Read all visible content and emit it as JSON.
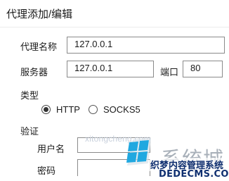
{
  "dialog": {
    "title": "代理添加/编辑"
  },
  "form": {
    "proxy_name_label": "代理名称",
    "proxy_name_value": "127.0.0.1",
    "server_label": "服务器",
    "server_value": "127.0.0.1",
    "port_label": "端口",
    "port_value": "80",
    "type_label": "类型",
    "type_options": [
      {
        "label": "HTTP",
        "selected": true
      },
      {
        "label": "SOCKS5",
        "selected": false
      }
    ],
    "auth_label": "验证",
    "username_label": "用户名",
    "username_value": "",
    "password_label": "密码",
    "password_value": ""
  },
  "watermark": {
    "site_sub": "xitongcheng.com",
    "brand": "系统城",
    "site_cn": "织梦内容管理系统",
    "site_en": "DEDECMS.COM"
  }
}
